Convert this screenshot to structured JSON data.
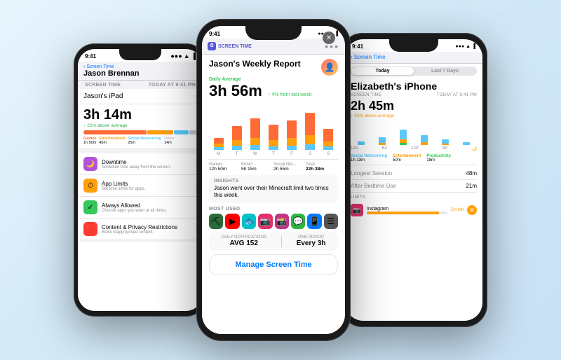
{
  "phones": {
    "left": {
      "status": {
        "time": "9:41",
        "signal": "●●●●",
        "wifi": "WiFi",
        "battery": "🔋"
      },
      "nav": {
        "back": "Screen Time",
        "title": "Jason Brennan"
      },
      "section_header": "SCREEN TIME",
      "date": "Today at 9:41 PM",
      "device_name": "Jason's iPad",
      "screen_time": "3h 14m",
      "avg_label": "22m above average",
      "usage": {
        "games_label": "Games",
        "games_time": "1h 50m",
        "ent_label": "Entertainment",
        "ent_time": "45m",
        "social_label": "Social Networking",
        "social_time": "25m",
        "other_label": "Other",
        "other_time": "14m"
      },
      "settings": [
        {
          "id": "downtime",
          "icon": "🌙",
          "color": "icon-purple",
          "title": "Downtime",
          "sub": "Schedule time away from the screen."
        },
        {
          "id": "app-limits",
          "icon": "⏱",
          "color": "icon-orange",
          "title": "App Limits",
          "sub": "Set time limits for apps."
        },
        {
          "id": "always-allowed",
          "icon": "✓",
          "color": "icon-green",
          "title": "Always Allowed",
          "sub": "Choose apps you want at all times."
        },
        {
          "id": "content-privacy",
          "icon": "🚫",
          "color": "icon-red",
          "title": "Content & Privacy Restrictions",
          "sub": "Block inappropriate content."
        }
      ]
    },
    "center": {
      "status": {
        "time": "9:41"
      },
      "app_label": "SCREEN TIME",
      "title": "Jason's Weekly Report",
      "daily_avg_label": "Daily Average",
      "daily_avg_time": "3h 56m",
      "pct_change": "↑ 4% from last week",
      "chart_days": [
        "M",
        "T",
        "W",
        "T",
        "F",
        "S",
        "S"
      ],
      "chart_stats": [
        {
          "label": "Games",
          "time": "12h 50m"
        },
        {
          "label": "Entert...",
          "time": "5h 15m"
        },
        {
          "label": "Social Net...",
          "time": "2h 55m"
        },
        {
          "label": "Total",
          "time": "22h 38m"
        }
      ],
      "insights_label": "Insights",
      "insights_text": "Jason went over their Minecraft limit two times this week.",
      "most_used_label": "Most Used",
      "apps": [
        "⛏️",
        "▶️",
        "🐟",
        "📸",
        "📷",
        "🔔",
        "📱",
        "☰"
      ],
      "notif_avg_label": "Daily Notifications",
      "notif_avg": "AVG 152",
      "pickup_label": "One Pickup",
      "pickup_value": "Every 3h",
      "manage_btn": "Manage Screen Time"
    },
    "right": {
      "status": {
        "time": "9:41"
      },
      "back_label": "Screen Time",
      "segment": {
        "active": "Today",
        "inactive": "Last 7 Days"
      },
      "device_name": "Elizabeth's iPhone",
      "section_header": "SCREEN TIME",
      "date": "Today at 9:41 PM",
      "screen_time": "2h 45m",
      "avg_label": "↑ 42m above average",
      "chart_time_labels": [
        "12A",
        "6A",
        "12P",
        "6P"
      ],
      "usage_cats": [
        {
          "label": "Social Networking",
          "time": "1h 13m",
          "color": "#5ac8fa"
        },
        {
          "label": "Entertainment",
          "time": "50m",
          "color": "#ff9f0a"
        },
        {
          "label": "Productivity",
          "time": "18m",
          "color": "#34c759"
        }
      ],
      "details": [
        {
          "label": "Longest Session",
          "value": "48m"
        },
        {
          "label": "After Bedtime Use",
          "value": "21m"
        }
      ],
      "limits_label": "LIMITS",
      "limits": [
        {
          "app": "Instagram",
          "icon": "📸",
          "remaining": "5m left"
        }
      ]
    }
  }
}
